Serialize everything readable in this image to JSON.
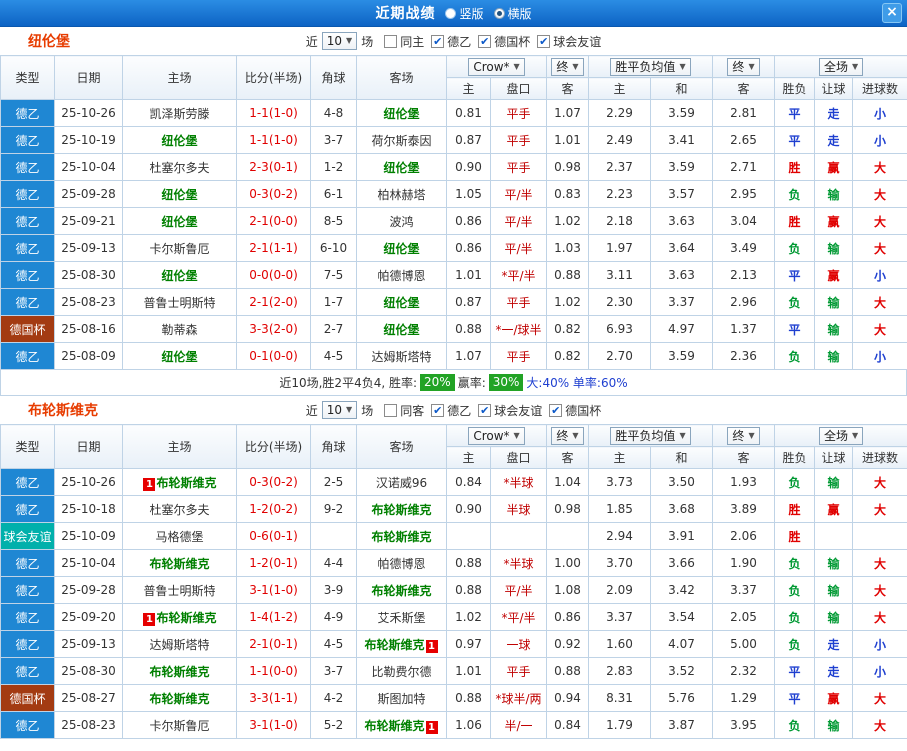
{
  "titlebar": {
    "title": "近期战绩",
    "radios": [
      {
        "label": "竖版",
        "selected": false
      },
      {
        "label": "横版",
        "selected": true
      }
    ],
    "close_label": "×"
  },
  "type_colors": {
    "德乙": "#1f87d3",
    "德国杯": "#a33b12",
    "球会友谊": "#01b0ab"
  },
  "result_colors": {
    "win": "#e00000",
    "draw": "#1e3fd0",
    "lose": "#009933"
  },
  "sections": [
    {
      "team": "纽伦堡",
      "filter": {
        "near": "近",
        "count": "10",
        "unit": "场",
        "checkboxes": [
          {
            "label": "同主",
            "checked": false
          },
          {
            "label": "德乙",
            "checked": true
          },
          {
            "label": "德国杯",
            "checked": true
          },
          {
            "label": "球会友谊",
            "checked": true
          }
        ]
      },
      "header": {
        "cols": [
          "类型",
          "日期",
          "主场",
          "比分(半场)",
          "角球",
          "客场"
        ],
        "odds_source": "Crow*",
        "final_1": "终",
        "avg_label": "胜平负均值",
        "final_2": "终",
        "scope": "全场",
        "subcols": [
          "主",
          "盘口",
          "客",
          "主",
          "和",
          "客",
          "胜负",
          "让球",
          "进球数"
        ]
      },
      "rows": [
        {
          "type": "德乙",
          "date": "25-10-26",
          "home": {
            "name": "凯泽斯劳滕",
            "hl": false
          },
          "score": "1-1(1-0)",
          "corners": "4-8",
          "away": {
            "name": "纽伦堡",
            "hl": true
          },
          "odds": [
            "0.81",
            "平手",
            "1.07"
          ],
          "avg": [
            "2.29",
            "3.59",
            "2.81"
          ],
          "results": [
            "平",
            "走",
            "小"
          ]
        },
        {
          "type": "德乙",
          "date": "25-10-19",
          "home": {
            "name": "纽伦堡",
            "hl": true
          },
          "score": "1-1(1-0)",
          "corners": "3-7",
          "away": {
            "name": "荷尔斯泰因",
            "hl": false
          },
          "odds": [
            "0.87",
            "平手",
            "1.01"
          ],
          "avg": [
            "2.49",
            "3.41",
            "2.65"
          ],
          "results": [
            "平",
            "走",
            "小"
          ]
        },
        {
          "type": "德乙",
          "date": "25-10-04",
          "home": {
            "name": "杜塞尔多夫",
            "hl": false
          },
          "score": "2-3(0-1)",
          "corners": "1-2",
          "away": {
            "name": "纽伦堡",
            "hl": true
          },
          "odds": [
            "0.90",
            "平手",
            "0.98"
          ],
          "avg": [
            "2.37",
            "3.59",
            "2.71"
          ],
          "results": [
            "胜",
            "赢",
            "大"
          ]
        },
        {
          "type": "德乙",
          "date": "25-09-28",
          "home": {
            "name": "纽伦堡",
            "hl": true
          },
          "score": "0-3(0-2)",
          "corners": "6-1",
          "away": {
            "name": "柏林赫塔",
            "hl": false
          },
          "odds": [
            "1.05",
            "平/半",
            "0.83"
          ],
          "avg": [
            "2.23",
            "3.57",
            "2.95"
          ],
          "results": [
            "负",
            "输",
            "大"
          ]
        },
        {
          "type": "德乙",
          "date": "25-09-21",
          "home": {
            "name": "纽伦堡",
            "hl": true
          },
          "score": "2-1(0-0)",
          "corners": "8-5",
          "away": {
            "name": "波鸿",
            "hl": false
          },
          "odds": [
            "0.86",
            "平/半",
            "1.02"
          ],
          "avg": [
            "2.18",
            "3.63",
            "3.04"
          ],
          "results": [
            "胜",
            "赢",
            "大"
          ]
        },
        {
          "type": "德乙",
          "date": "25-09-13",
          "home": {
            "name": "卡尔斯鲁厄",
            "hl": false
          },
          "score": "2-1(1-1)",
          "corners": "6-10",
          "away": {
            "name": "纽伦堡",
            "hl": true
          },
          "odds": [
            "0.86",
            "平/半",
            "1.03"
          ],
          "avg": [
            "1.97",
            "3.64",
            "3.49"
          ],
          "results": [
            "负",
            "输",
            "大"
          ]
        },
        {
          "type": "德乙",
          "date": "25-08-30",
          "home": {
            "name": "纽伦堡",
            "hl": true
          },
          "score": "0-0(0-0)",
          "corners": "7-5",
          "away": {
            "name": "帕德博恩",
            "hl": false
          },
          "odds": [
            "1.01",
            "*平/半",
            "0.88"
          ],
          "avg": [
            "3.11",
            "3.63",
            "2.13"
          ],
          "results": [
            "平",
            "赢",
            "小"
          ]
        },
        {
          "type": "德乙",
          "date": "25-08-23",
          "home": {
            "name": "普鲁士明斯特",
            "hl": false
          },
          "score": "2-1(2-0)",
          "corners": "1-7",
          "away": {
            "name": "纽伦堡",
            "hl": true
          },
          "odds": [
            "0.87",
            "平手",
            "1.02"
          ],
          "avg": [
            "2.30",
            "3.37",
            "2.96"
          ],
          "results": [
            "负",
            "输",
            "大"
          ]
        },
        {
          "type": "德国杯",
          "date": "25-08-16",
          "home": {
            "name": "勒蒂森",
            "hl": false
          },
          "score": "3-3(2-0)",
          "corners": "2-7",
          "away": {
            "name": "纽伦堡",
            "hl": true
          },
          "odds": [
            "0.88",
            "*一/球半",
            "0.82"
          ],
          "avg": [
            "6.93",
            "4.97",
            "1.37"
          ],
          "results": [
            "平",
            "输",
            "大"
          ]
        },
        {
          "type": "德乙",
          "date": "25-08-09",
          "home": {
            "name": "纽伦堡",
            "hl": true
          },
          "score": "0-1(0-0)",
          "corners": "4-5",
          "away": {
            "name": "达姆斯塔特",
            "hl": false
          },
          "odds": [
            "1.07",
            "平手",
            "0.82"
          ],
          "avg": [
            "2.70",
            "3.59",
            "2.36"
          ],
          "results": [
            "负",
            "输",
            "小"
          ]
        }
      ],
      "footer": {
        "prefix": "近10场,胜2平4负4, 胜率: ",
        "win_rate": "20%",
        "mid": " 赢率: ",
        "cover_rate": "30%",
        "suffix": " 大:40% 单率:60%"
      }
    },
    {
      "team": "布轮斯维克",
      "filter": {
        "near": "近",
        "count": "10",
        "unit": "场",
        "checkboxes": [
          {
            "label": "同客",
            "checked": false
          },
          {
            "label": "德乙",
            "checked": true
          },
          {
            "label": "球会友谊",
            "checked": true
          },
          {
            "label": "德国杯",
            "checked": true
          }
        ]
      },
      "header": {
        "cols": [
          "类型",
          "日期",
          "主场",
          "比分(半场)",
          "角球",
          "客场"
        ],
        "odds_source": "Crow*",
        "final_1": "终",
        "avg_label": "胜平负均值",
        "final_2": "终",
        "scope": "全场",
        "subcols": [
          "主",
          "盘口",
          "客",
          "主",
          "和",
          "客",
          "胜负",
          "让球",
          "进球数"
        ]
      },
      "rows": [
        {
          "type": "德乙",
          "date": "25-10-26",
          "home": {
            "name": "布轮斯维克",
            "hl": true,
            "badge": "1",
            "badge_pos": "before"
          },
          "score": "0-3(0-2)",
          "corners": "2-5",
          "away": {
            "name": "汉诺威96",
            "hl": false
          },
          "odds": [
            "0.84",
            "*半球",
            "1.04"
          ],
          "avg": [
            "3.73",
            "3.50",
            "1.93"
          ],
          "results": [
            "负",
            "输",
            "大"
          ]
        },
        {
          "type": "德乙",
          "date": "25-10-18",
          "home": {
            "name": "杜塞尔多夫",
            "hl": false
          },
          "score": "1-2(0-2)",
          "corners": "9-2",
          "away": {
            "name": "布轮斯维克",
            "hl": true
          },
          "odds": [
            "0.90",
            "半球",
            "0.98"
          ],
          "avg": [
            "1.85",
            "3.68",
            "3.89"
          ],
          "results": [
            "胜",
            "赢",
            "大"
          ]
        },
        {
          "type": "球会友谊",
          "date": "25-10-09",
          "home": {
            "name": "马格德堡",
            "hl": false
          },
          "score": "0-6(0-1)",
          "corners": "",
          "away": {
            "name": "布轮斯维克",
            "hl": true
          },
          "odds": [
            "",
            "",
            ""
          ],
          "avg": [
            "2.94",
            "3.91",
            "2.06"
          ],
          "results": [
            "胜",
            "",
            ""
          ]
        },
        {
          "type": "德乙",
          "date": "25-10-04",
          "home": {
            "name": "布轮斯维克",
            "hl": true
          },
          "score": "1-2(0-1)",
          "corners": "4-4",
          "away": {
            "name": "帕德博恩",
            "hl": false
          },
          "odds": [
            "0.88",
            "*半球",
            "1.00"
          ],
          "avg": [
            "3.70",
            "3.66",
            "1.90"
          ],
          "results": [
            "负",
            "输",
            "大"
          ]
        },
        {
          "type": "德乙",
          "date": "25-09-28",
          "home": {
            "name": "普鲁士明斯特",
            "hl": false
          },
          "score": "3-1(1-0)",
          "corners": "3-9",
          "away": {
            "name": "布轮斯维克",
            "hl": true
          },
          "odds": [
            "0.88",
            "平/半",
            "1.08"
          ],
          "avg": [
            "2.09",
            "3.42",
            "3.37"
          ],
          "results": [
            "负",
            "输",
            "大"
          ]
        },
        {
          "type": "德乙",
          "date": "25-09-20",
          "home": {
            "name": "布轮斯维克",
            "hl": true,
            "badge": "1",
            "badge_pos": "before"
          },
          "score": "1-4(1-2)",
          "corners": "4-9",
          "away": {
            "name": "艾禾斯堡",
            "hl": false
          },
          "odds": [
            "1.02",
            "*平/半",
            "0.86"
          ],
          "avg": [
            "3.37",
            "3.54",
            "2.05"
          ],
          "results": [
            "负",
            "输",
            "大"
          ]
        },
        {
          "type": "德乙",
          "date": "25-09-13",
          "home": {
            "name": "达姆斯塔特",
            "hl": false
          },
          "score": "2-1(0-1)",
          "corners": "4-5",
          "away": {
            "name": "布轮斯维克",
            "hl": true,
            "badge": "1",
            "badge_pos": "after"
          },
          "odds": [
            "0.97",
            "一球",
            "0.92"
          ],
          "avg": [
            "1.60",
            "4.07",
            "5.00"
          ],
          "results": [
            "负",
            "走",
            "小"
          ]
        },
        {
          "type": "德乙",
          "date": "25-08-30",
          "home": {
            "name": "布轮斯维克",
            "hl": true
          },
          "score": "1-1(0-0)",
          "corners": "3-7",
          "away": {
            "name": "比勒费尔德",
            "hl": false
          },
          "odds": [
            "1.01",
            "平手",
            "0.88"
          ],
          "avg": [
            "2.83",
            "3.52",
            "2.32"
          ],
          "results": [
            "平",
            "走",
            "小"
          ]
        },
        {
          "type": "德国杯",
          "date": "25-08-27",
          "home": {
            "name": "布轮斯维克",
            "hl": true
          },
          "score": "3-3(1-1)",
          "corners": "4-2",
          "away": {
            "name": "斯图加特",
            "hl": false
          },
          "odds": [
            "0.88",
            "*球半/两",
            "0.94"
          ],
          "avg": [
            "8.31",
            "5.76",
            "1.29"
          ],
          "results": [
            "平",
            "赢",
            "大"
          ]
        },
        {
          "type": "德乙",
          "date": "25-08-23",
          "home": {
            "name": "卡尔斯鲁厄",
            "hl": false
          },
          "score": "3-1(1-0)",
          "corners": "5-2",
          "away": {
            "name": "布轮斯维克",
            "hl": true,
            "badge": "1",
            "badge_pos": "after"
          },
          "odds": [
            "1.06",
            "半/一",
            "0.84"
          ],
          "avg": [
            "1.79",
            "3.87",
            "3.95"
          ],
          "results": [
            "负",
            "输",
            "大"
          ]
        }
      ]
    }
  ]
}
